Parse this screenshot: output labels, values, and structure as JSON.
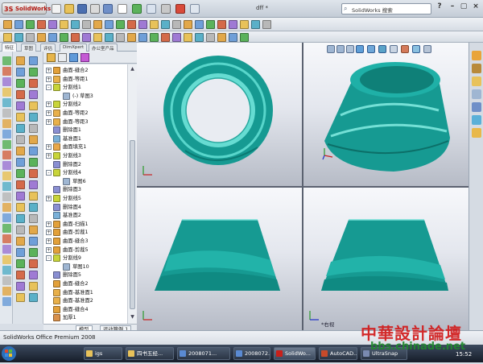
{
  "app": {
    "logo_text": "SolidWorks",
    "document_title": "dff *",
    "search_placeholder": "SolidWorks 搜索"
  },
  "command_tabs": [
    {
      "label": "特征"
    },
    {
      "label": "草图"
    },
    {
      "label": "评估"
    },
    {
      "label": "DimXpert"
    },
    {
      "label": "办公室产品"
    }
  ],
  "feature_tree": {
    "items": [
      {
        "label": "曲面-缝合2",
        "expand": "+",
        "icon": "surface-knit-icon",
        "level": 0
      },
      {
        "label": "曲面-等距1",
        "expand": "+",
        "icon": "surface-offset-icon",
        "level": 0
      },
      {
        "label": "分割线1",
        "expand": "-",
        "icon": "split-line-icon",
        "level": 0
      },
      {
        "label": "(-) 草图3",
        "expand": "",
        "icon": "sketch-icon",
        "level": 1
      },
      {
        "label": "分割线2",
        "expand": "+",
        "icon": "split-line-icon",
        "level": 0
      },
      {
        "label": "曲面-等距2",
        "expand": "+",
        "icon": "surface-offset-icon",
        "level": 0
      },
      {
        "label": "曲面-等距3",
        "expand": "+",
        "icon": "surface-offset-icon",
        "level": 0
      },
      {
        "label": "删除面1",
        "expand": "",
        "icon": "delete-face-icon",
        "level": 0
      },
      {
        "label": "基准面1",
        "expand": "",
        "icon": "plane-icon",
        "level": 0
      },
      {
        "label": "曲面填充1",
        "expand": "+",
        "icon": "surface-fill-icon",
        "level": 0
      },
      {
        "label": "分割线3",
        "expand": "+",
        "icon": "split-line-icon",
        "level": 0
      },
      {
        "label": "删除面2",
        "expand": "",
        "icon": "delete-face-icon",
        "level": 0
      },
      {
        "label": "分割线4",
        "expand": "-",
        "icon": "split-line-icon",
        "level": 0
      },
      {
        "label": "草图6",
        "expand": "",
        "icon": "sketch-icon",
        "level": 1
      },
      {
        "label": "删除面3",
        "expand": "",
        "icon": "delete-face-icon",
        "level": 0
      },
      {
        "label": "分割线5",
        "expand": "+",
        "icon": "split-line-icon",
        "level": 0
      },
      {
        "label": "删除面4",
        "expand": "",
        "icon": "delete-face-icon",
        "level": 0
      },
      {
        "label": "基准面2",
        "expand": "",
        "icon": "plane-icon",
        "level": 0
      },
      {
        "label": "曲面-扫描1",
        "expand": "+",
        "icon": "surface-sweep-icon",
        "level": 0
      },
      {
        "label": "曲面-剪裁1",
        "expand": "+",
        "icon": "surface-trim-icon",
        "level": 0
      },
      {
        "label": "曲面-缝合3",
        "expand": "+",
        "icon": "surface-knit-icon",
        "level": 0
      },
      {
        "label": "曲面-剪裁5",
        "expand": "+",
        "icon": "surface-trim-icon",
        "level": 0
      },
      {
        "label": "分割线9",
        "expand": "-",
        "icon": "split-line-icon",
        "level": 0
      },
      {
        "label": "草图10",
        "expand": "",
        "icon": "sketch-icon",
        "level": 1
      },
      {
        "label": "删除面5",
        "expand": "",
        "icon": "delete-face-icon",
        "level": 0
      },
      {
        "label": "曲面-缝合2",
        "expand": "",
        "icon": "surface-knit-icon",
        "level": 0
      },
      {
        "label": "曲面-基准面1",
        "expand": "",
        "icon": "surface-plane-icon",
        "level": 0
      },
      {
        "label": "曲面-基准面2",
        "expand": "",
        "icon": "surface-plane-icon",
        "level": 0
      },
      {
        "label": "曲面-缝合4",
        "expand": "",
        "icon": "surface-knit-icon",
        "level": 0
      },
      {
        "label": "加厚1",
        "expand": "",
        "icon": "thicken-icon",
        "level": 0
      }
    ]
  },
  "bottom_tabs": [
    {
      "label": "模型"
    },
    {
      "label": "运动算例 1"
    }
  ],
  "viewports": [
    {
      "name": "top-view",
      "label": ""
    },
    {
      "name": "isometric-view",
      "label": ""
    },
    {
      "name": "front-view",
      "label": ""
    },
    {
      "name": "right-view",
      "label": "*右视"
    }
  ],
  "status": {
    "text": "SolidWorks Office Premium 2008"
  },
  "taskbar": {
    "items": [
      {
        "label": "igs"
      },
      {
        "label": "四书五经..."
      },
      {
        "label": "2008071..."
      },
      {
        "label": "2008072..."
      },
      {
        "label": "SolidWo..."
      },
      {
        "label": "AutoCAD..."
      },
      {
        "label": "UltraSnap"
      }
    ],
    "clock": "15:52"
  },
  "watermark": {
    "line1": "中華設計論壇",
    "line2": "bbs.chinade.net"
  },
  "colors": {
    "model_teal": "#1aa39b",
    "model_highlight": "#7fe3da",
    "accent_red": "#c8201a"
  }
}
